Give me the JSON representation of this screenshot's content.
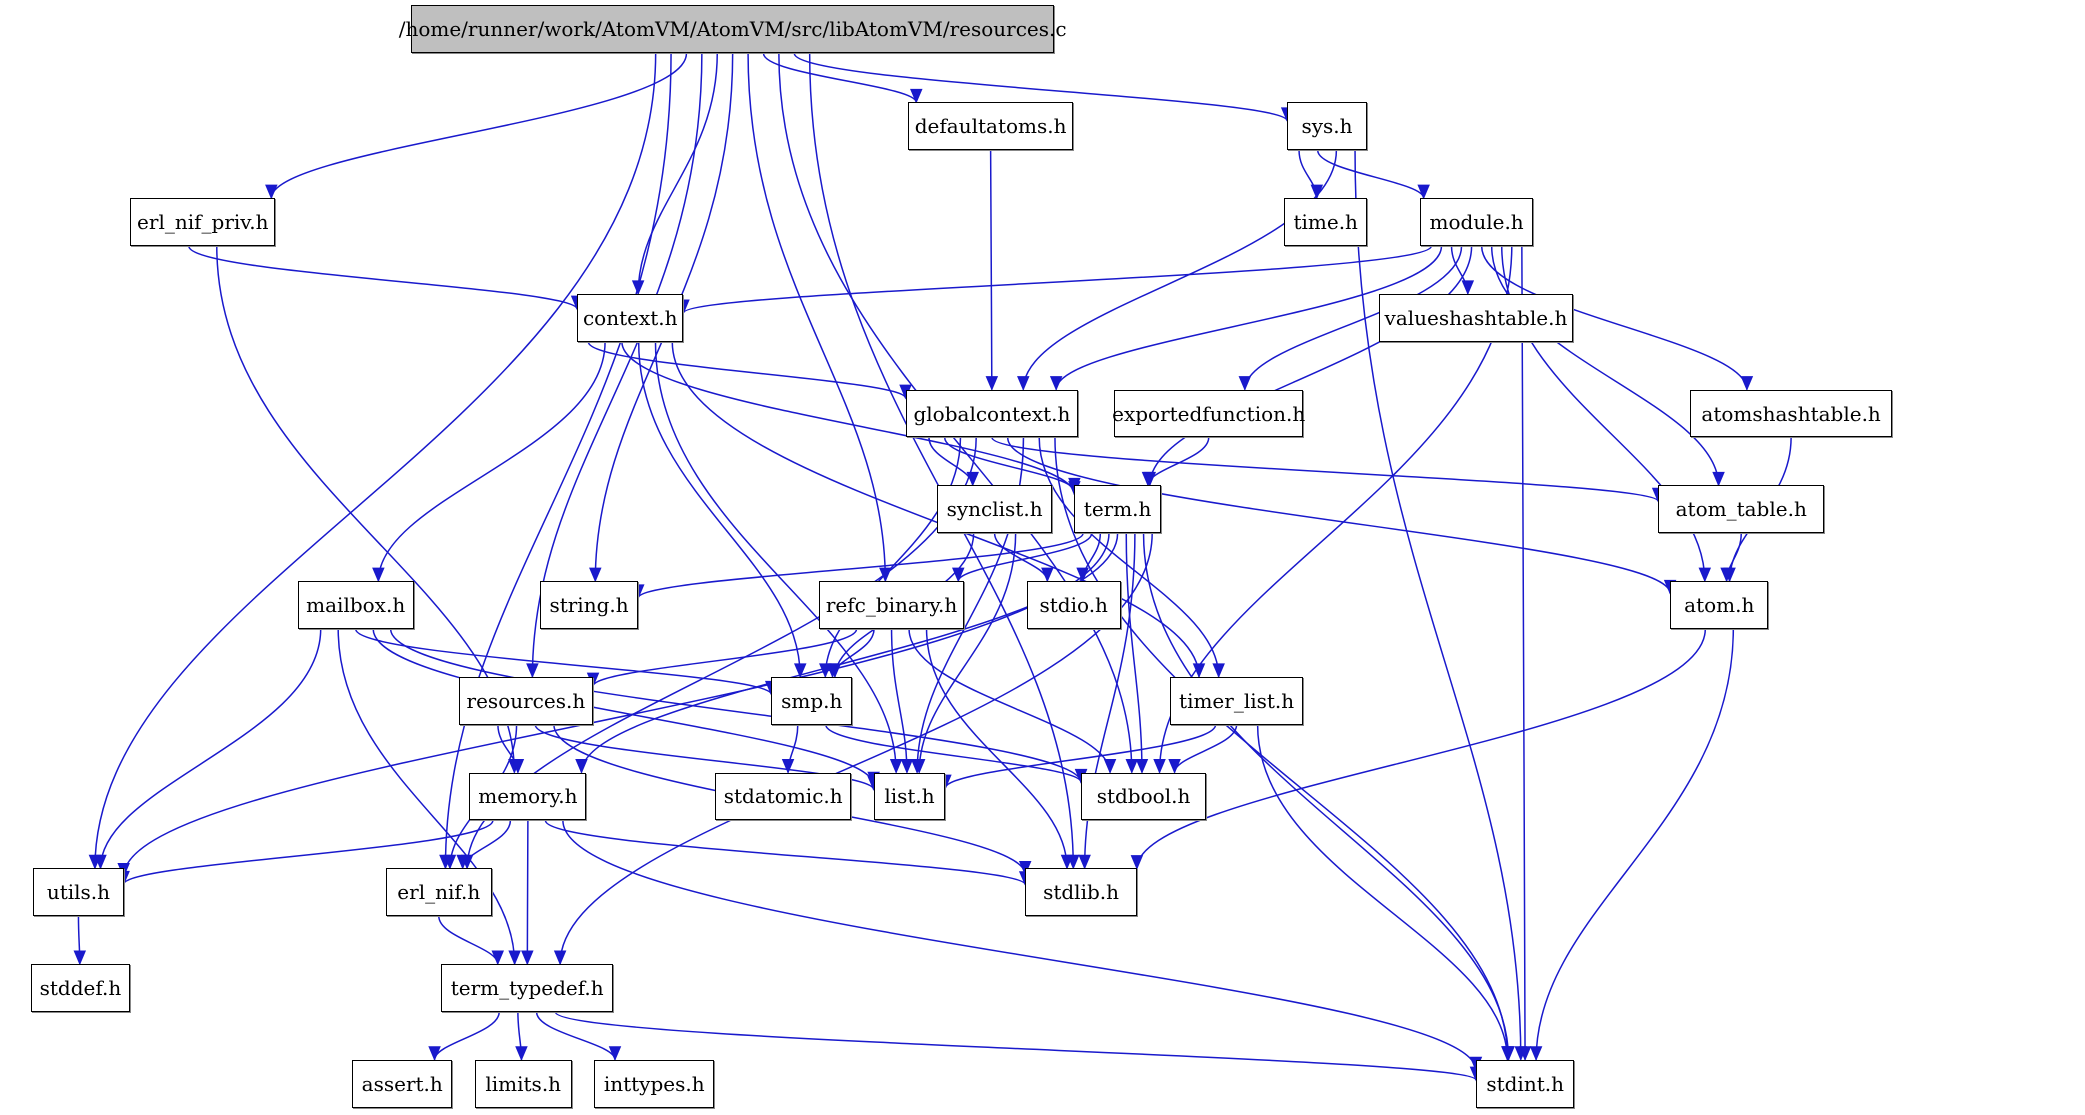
{
  "graph": {
    "title": "/home/runner/work/AtomVM/AtomVM/src/libAtomVM/resources.c",
    "colors": {
      "edge": "#1919cc",
      "root_fill": "#bfbfbf",
      "node_fill": "#ffffff",
      "node_border": "#000000"
    },
    "nodes": {
      "root": "/home/runner/work/AtomVM/AtomVM/src/libAtomVM/resources.c",
      "defaultatoms": "defaultatoms.h",
      "sys": "sys.h",
      "erl_nif_priv": "erl_nif_priv.h",
      "time": "time.h",
      "module": "module.h",
      "context": "context.h",
      "valueshashtable": "valueshashtable.h",
      "globalcontext": "globalcontext.h",
      "exportedfunction": "exportedfunction.h",
      "atomshashtable": "atomshashtable.h",
      "synclist": "synclist.h",
      "term": "term.h",
      "atom_table": "atom_table.h",
      "mailbox": "mailbox.h",
      "string": "string.h",
      "refc_binary": "refc_binary.h",
      "stdio": "stdio.h",
      "atom": "atom.h",
      "resources": "resources.h",
      "smp": "smp.h",
      "timer_list": "timer_list.h",
      "memory": "memory.h",
      "stdatomic": "stdatomic.h",
      "list": "list.h",
      "stdbool": "stdbool.h",
      "utils": "utils.h",
      "erl_nif": "erl_nif.h",
      "stdlib": "stdlib.h",
      "stddef": "stddef.h",
      "term_typedef": "term_typedef.h",
      "assert": "assert.h",
      "limits": "limits.h",
      "inttypes": "inttypes.h",
      "stdint": "stdint.h"
    },
    "edges": [
      [
        "root",
        "utils"
      ],
      [
        "root",
        "erl_nif"
      ],
      [
        "root",
        "erl_nif_priv"
      ],
      [
        "root",
        "resources"
      ],
      [
        "root",
        "context"
      ],
      [
        "root",
        "string"
      ],
      [
        "root",
        "refc_binary"
      ],
      [
        "root",
        "defaultatoms"
      ],
      [
        "root",
        "stdbool"
      ],
      [
        "root",
        "sys"
      ],
      [
        "root",
        "stdlib"
      ],
      [
        "defaultatoms",
        "globalcontext"
      ],
      [
        "sys",
        "time"
      ],
      [
        "sys",
        "module"
      ],
      [
        "sys",
        "globalcontext"
      ],
      [
        "sys",
        "stdint"
      ],
      [
        "erl_nif_priv",
        "context"
      ],
      [
        "erl_nif_priv",
        "memory"
      ],
      [
        "module",
        "context"
      ],
      [
        "module",
        "globalcontext"
      ],
      [
        "module",
        "valueshashtable"
      ],
      [
        "module",
        "exportedfunction"
      ],
      [
        "module",
        "term"
      ],
      [
        "module",
        "atomshashtable"
      ],
      [
        "module",
        "atom_table"
      ],
      [
        "module",
        "atom"
      ],
      [
        "module",
        "stdbool"
      ],
      [
        "module",
        "stdint"
      ],
      [
        "context",
        "globalcontext"
      ],
      [
        "context",
        "mailbox"
      ],
      [
        "context",
        "term"
      ],
      [
        "context",
        "smp"
      ],
      [
        "context",
        "list"
      ],
      [
        "context",
        "timer_list"
      ],
      [
        "globalcontext",
        "synclist"
      ],
      [
        "globalcontext",
        "term"
      ],
      [
        "globalcontext",
        "smp"
      ],
      [
        "globalcontext",
        "erl_nif"
      ],
      [
        "globalcontext",
        "atom_table"
      ],
      [
        "globalcontext",
        "atom"
      ],
      [
        "globalcontext",
        "list"
      ],
      [
        "globalcontext",
        "timer_list"
      ],
      [
        "globalcontext",
        "stdint"
      ],
      [
        "exportedfunction",
        "term"
      ],
      [
        "atomshashtable",
        "atom"
      ],
      [
        "atom_table",
        "atom"
      ],
      [
        "synclist",
        "smp"
      ],
      [
        "synclist",
        "stdio"
      ],
      [
        "synclist",
        "list"
      ],
      [
        "term",
        "string"
      ],
      [
        "term",
        "refc_binary"
      ],
      [
        "term",
        "stdio"
      ],
      [
        "term",
        "utils"
      ],
      [
        "term",
        "memory"
      ],
      [
        "term",
        "stdbool"
      ],
      [
        "term",
        "stdlib"
      ],
      [
        "term",
        "stdint"
      ],
      [
        "term",
        "term_typedef"
      ],
      [
        "mailbox",
        "utils"
      ],
      [
        "mailbox",
        "term_typedef"
      ],
      [
        "mailbox",
        "smp"
      ],
      [
        "mailbox",
        "list"
      ],
      [
        "mailbox",
        "stdbool"
      ],
      [
        "refc_binary",
        "resources"
      ],
      [
        "refc_binary",
        "smp"
      ],
      [
        "refc_binary",
        "list"
      ],
      [
        "refc_binary",
        "stdbool"
      ],
      [
        "refc_binary",
        "stdlib"
      ],
      [
        "atom",
        "stdlib"
      ],
      [
        "atom",
        "stdint"
      ],
      [
        "resources",
        "memory"
      ],
      [
        "resources",
        "erl_nif"
      ],
      [
        "resources",
        "list"
      ],
      [
        "resources",
        "stdlib"
      ],
      [
        "smp",
        "stdatomic"
      ],
      [
        "smp",
        "stdbool"
      ],
      [
        "timer_list",
        "list"
      ],
      [
        "timer_list",
        "stdbool"
      ],
      [
        "timer_list",
        "stdint"
      ],
      [
        "memory",
        "utils"
      ],
      [
        "memory",
        "erl_nif"
      ],
      [
        "memory",
        "term_typedef"
      ],
      [
        "memory",
        "stdlib"
      ],
      [
        "memory",
        "stdint"
      ],
      [
        "utils",
        "stddef"
      ],
      [
        "erl_nif",
        "term_typedef"
      ],
      [
        "term_typedef",
        "assert"
      ],
      [
        "term_typedef",
        "limits"
      ],
      [
        "term_typedef",
        "inttypes"
      ],
      [
        "term_typedef",
        "stdint"
      ]
    ]
  }
}
